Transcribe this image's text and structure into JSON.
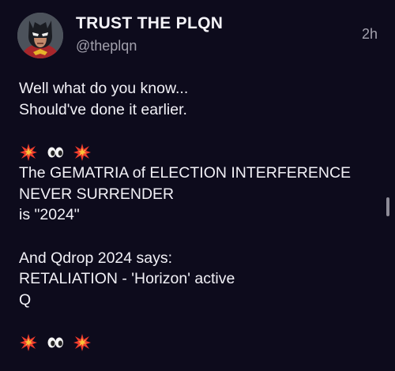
{
  "post": {
    "author": {
      "display_name": "TRUST THE PLQN",
      "handle": "@theplqn",
      "avatar_icon": "masked-hero-avatar-icon"
    },
    "timestamp": "2h",
    "lines": [
      "Well what do you know...",
      "Should've done it earlier.",
      "The GEMATRIA of ELECTION INTERFERENCE",
      "NEVER SURRENDER",
      "is \"2024\"",
      "And Qdrop 2024 says:",
      "RETALIATION - 'Horizon' active",
      "Q"
    ],
    "emoji_rows": [
      [
        "collision-emoji",
        "eyes-emoji",
        "collision-emoji"
      ],
      [
        "collision-emoji",
        "eyes-emoji",
        "collision-emoji"
      ]
    ]
  },
  "colors": {
    "background": "#0d0b1c",
    "text_primary": "#f2f1f7",
    "text_secondary": "#a3a1ad"
  }
}
